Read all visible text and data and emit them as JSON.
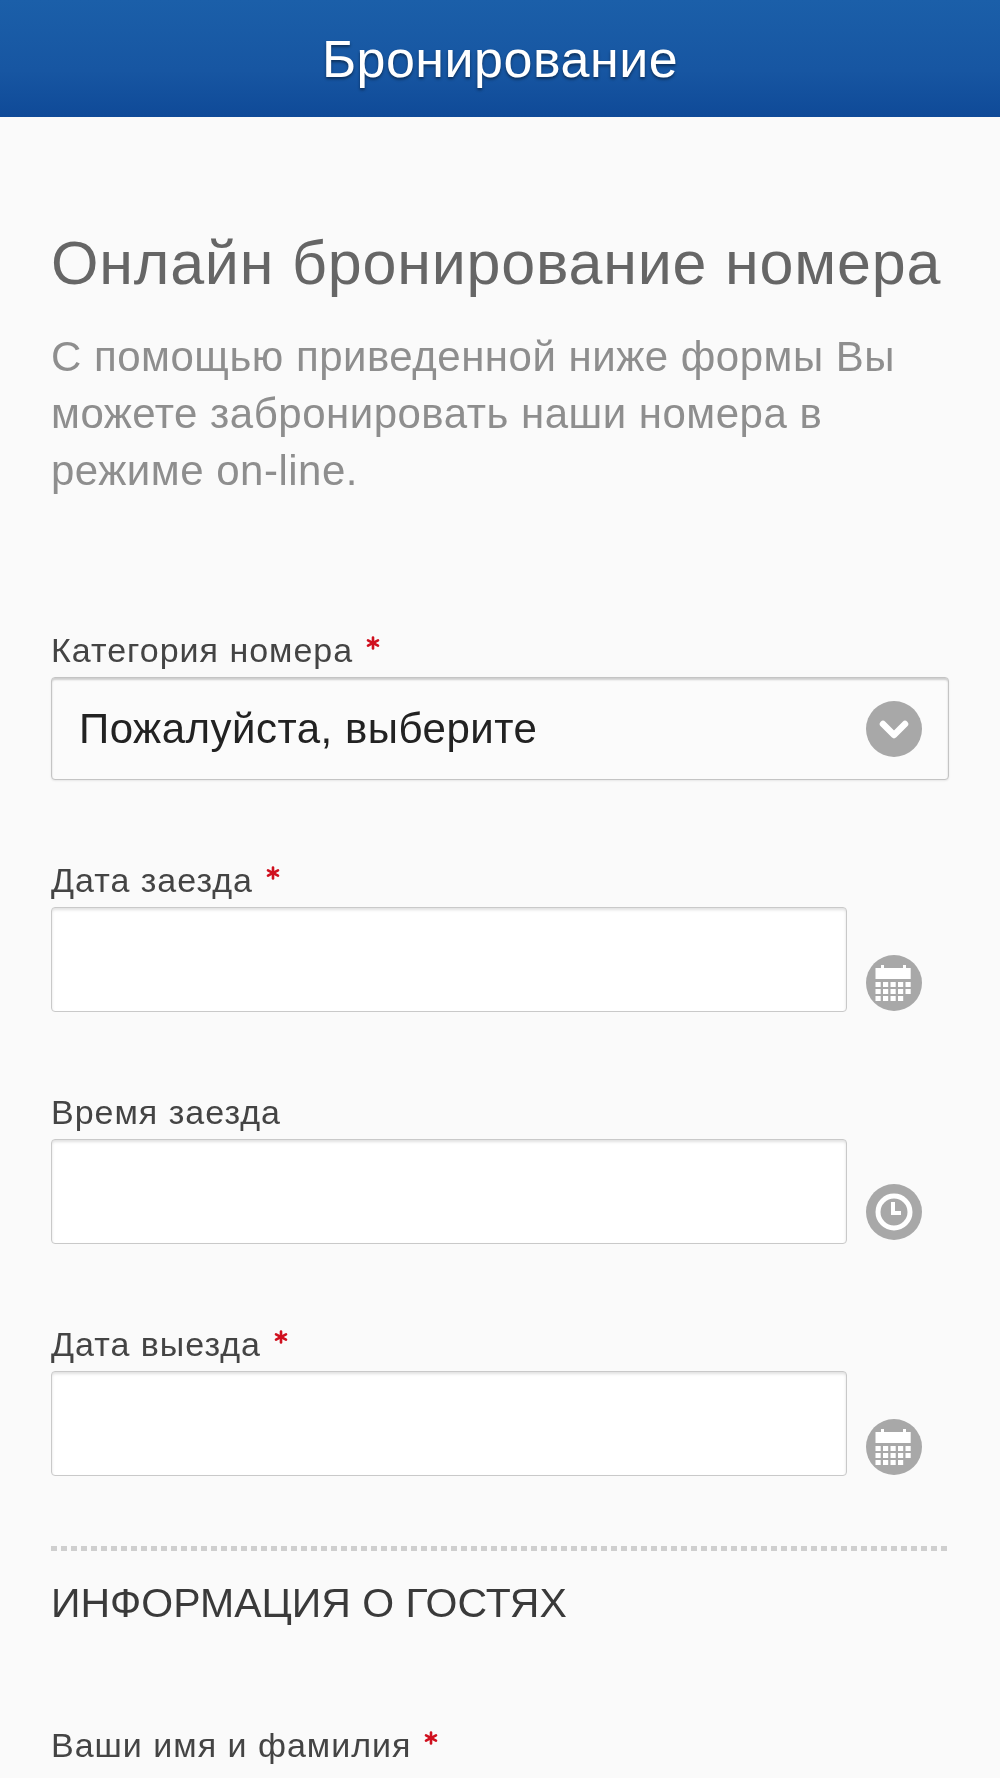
{
  "header": {
    "title": "Бронирование"
  },
  "intro": {
    "heading": "Онлайн бронирование номера",
    "text": "С помощью приведенной ниже формы Вы можете забронировать наши номера в режиме on-line."
  },
  "fields": [
    {
      "kind": "select",
      "label": "Категория номера",
      "required": true,
      "value": "Пожалуйста, выберите"
    },
    {
      "kind": "date",
      "label": "Дата заезда",
      "required": true
    },
    {
      "kind": "time",
      "label": "Время заезда",
      "required": false
    },
    {
      "kind": "date",
      "label": "Дата выезда",
      "required": true
    }
  ],
  "guests": {
    "title": "ИНФОРМАЦИЯ О ГОСТЯХ",
    "fields": [
      {
        "label": "Ваши имя и фамилия",
        "required": true
      }
    ]
  }
}
